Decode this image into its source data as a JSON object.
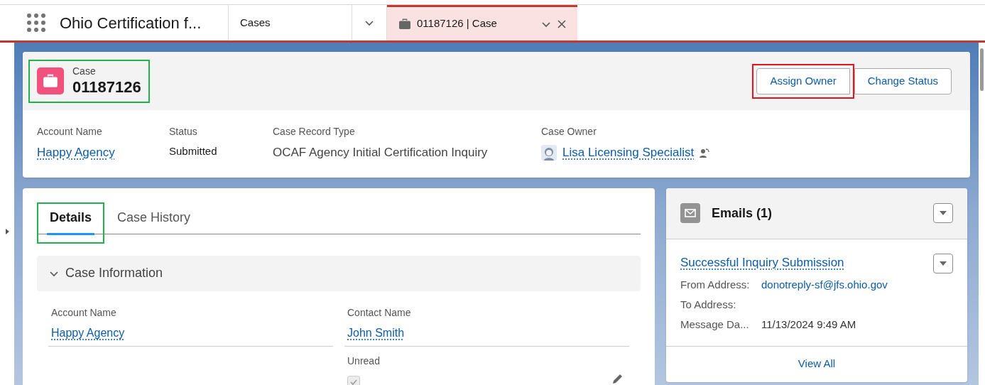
{
  "app_bar": {
    "app_name": "Ohio Certification f...",
    "tabs": [
      {
        "label": "Cases",
        "selected": false,
        "kind": "nav"
      },
      {
        "label": "01187126 | Case",
        "selected": true,
        "kind": "record"
      }
    ]
  },
  "record": {
    "object": "Case",
    "number": "01187126",
    "highlighted": true,
    "actions": [
      {
        "label": "Assign Owner",
        "highlighted": true
      },
      {
        "label": "Change Status",
        "highlighted": false
      }
    ],
    "fields": [
      {
        "label": "Account Name",
        "value": "Happy Agency",
        "kind": "link"
      },
      {
        "label": "Status",
        "value": "Submitted",
        "kind": "strong"
      },
      {
        "label": "Case Record Type",
        "value": "OCAF Agency Initial Certification Inquiry",
        "kind": "text"
      },
      {
        "label": "Case Owner",
        "value": "Lisa Licensing Specialist",
        "kind": "owner"
      }
    ]
  },
  "detail_tabs": [
    {
      "label": "Details",
      "selected": true,
      "highlighted": true
    },
    {
      "label": "Case History",
      "selected": false,
      "highlighted": false
    }
  ],
  "section": {
    "title": "Case Information",
    "expanded": true,
    "columns": [
      [
        {
          "label": "Account Name",
          "value": "Happy Agency",
          "kind": "link"
        }
      ],
      [
        {
          "label": "Contact Name",
          "value": "John Smith",
          "kind": "link"
        },
        {
          "label": "Unread",
          "checked": true,
          "kind": "checkbox"
        }
      ]
    ]
  },
  "emails": {
    "title": "Emails (1)",
    "items": [
      {
        "subject": "Successful Inquiry Submission",
        "rows": [
          {
            "label": "From Address:",
            "value": "donotreply-sf@jfs.ohio.gov",
            "kind": "link"
          },
          {
            "label": "To Address:",
            "kind": "empty"
          },
          {
            "label": "Message Da...",
            "value": "11/13/2024 9:49 AM",
            "kind": "text"
          }
        ]
      }
    ],
    "view_all": "View All"
  }
}
